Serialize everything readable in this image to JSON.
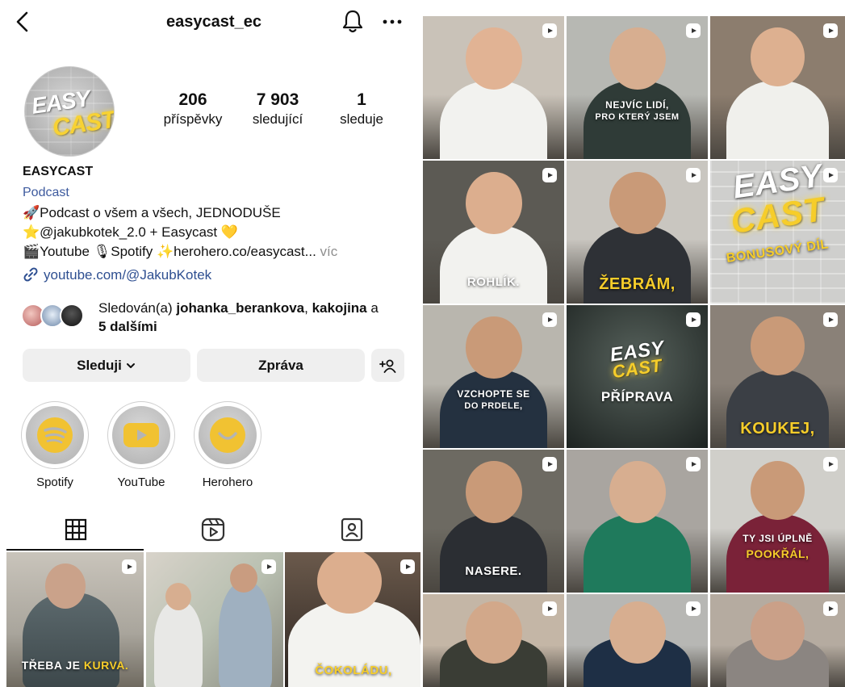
{
  "header": {
    "title": "easycast_ec"
  },
  "avatar": {
    "text_line1": "EASY",
    "text_line2": "CAST"
  },
  "stats": [
    {
      "value": "206",
      "label": "příspěvky"
    },
    {
      "value": "7 903",
      "label": "sledující"
    },
    {
      "value": "1",
      "label": "sleduje"
    }
  ],
  "profile": {
    "name": "EASYCAST",
    "category": "Podcast",
    "bio_lines": [
      "🚀Podcast o všem a všech, JEDNODUŠE",
      "⭐@jakubkotek_2.0 + Easycast 💛",
      "🎬Youtube 🎙Spotify ✨herohero.co/easycast..."
    ],
    "bio_more": " víc",
    "link": "youtube.com/@JakubKotek"
  },
  "followed_by": {
    "prefix": "Sledován(a) ",
    "user1": "johanka_berankova",
    "sep": ", ",
    "user2": "kakojina",
    "and": " a",
    "others": "5 dalšími"
  },
  "buttons": {
    "following": "Sleduji",
    "message": "Zpráva"
  },
  "highlights": [
    {
      "label": "Spotify",
      "icon": "spotify-icon",
      "color": "#f1c232"
    },
    {
      "label": "YouTube",
      "icon": "youtube-icon",
      "color": "#f1c232"
    },
    {
      "label": "Herohero",
      "icon": "smile-icon",
      "color": "#f1c232"
    }
  ],
  "tabs": [
    "grid",
    "reels",
    "tagged"
  ],
  "left_thumbs": [
    {
      "caption_white": "TŘEBA JE ",
      "caption_yellow": "KURVA."
    },
    {
      "caption_white": "",
      "caption_yellow": ""
    },
    {
      "caption_white": "",
      "caption_yellow": "ČOKOLÁDU,"
    }
  ],
  "grid": [
    {
      "caption": "",
      "caption_sub": ""
    },
    {
      "caption": "NEJVÍC LIDÍ,",
      "caption_sub": "PRO KTERÝ JSEM"
    },
    {
      "caption": "",
      "caption_sub": ""
    },
    {
      "caption": "ROHLÍK.",
      "caption_sub": ""
    },
    {
      "caption": "ŽEBRÁM,",
      "caption_sub": ""
    },
    {
      "caption": "EASY",
      "caption_sub": "CAST",
      "caption_extra": "BONUSOVÝ DÍL"
    },
    {
      "caption": "VZCHOPTE SE",
      "caption_sub": "DO PRDELE,"
    },
    {
      "caption": "EASY",
      "caption_sub": "CAST",
      "caption_extra": "PŘÍPRAVA"
    },
    {
      "caption": "KOUKEJ,",
      "caption_sub": ""
    },
    {
      "caption": "NASERE.",
      "caption_sub": ""
    },
    {
      "caption": "",
      "caption_sub": ""
    },
    {
      "caption": "TY JSI ÚPLNĚ",
      "caption_sub": "POOKŘÁL,"
    },
    {
      "caption": "",
      "caption_sub": ""
    },
    {
      "caption": "",
      "caption_sub": ""
    },
    {
      "caption": "",
      "caption_sub": ""
    }
  ],
  "colors": {
    "link": "#2e4f91",
    "category": "#3d5a9e",
    "yellow": "#f6cd2a",
    "button_bg": "#efefef"
  }
}
